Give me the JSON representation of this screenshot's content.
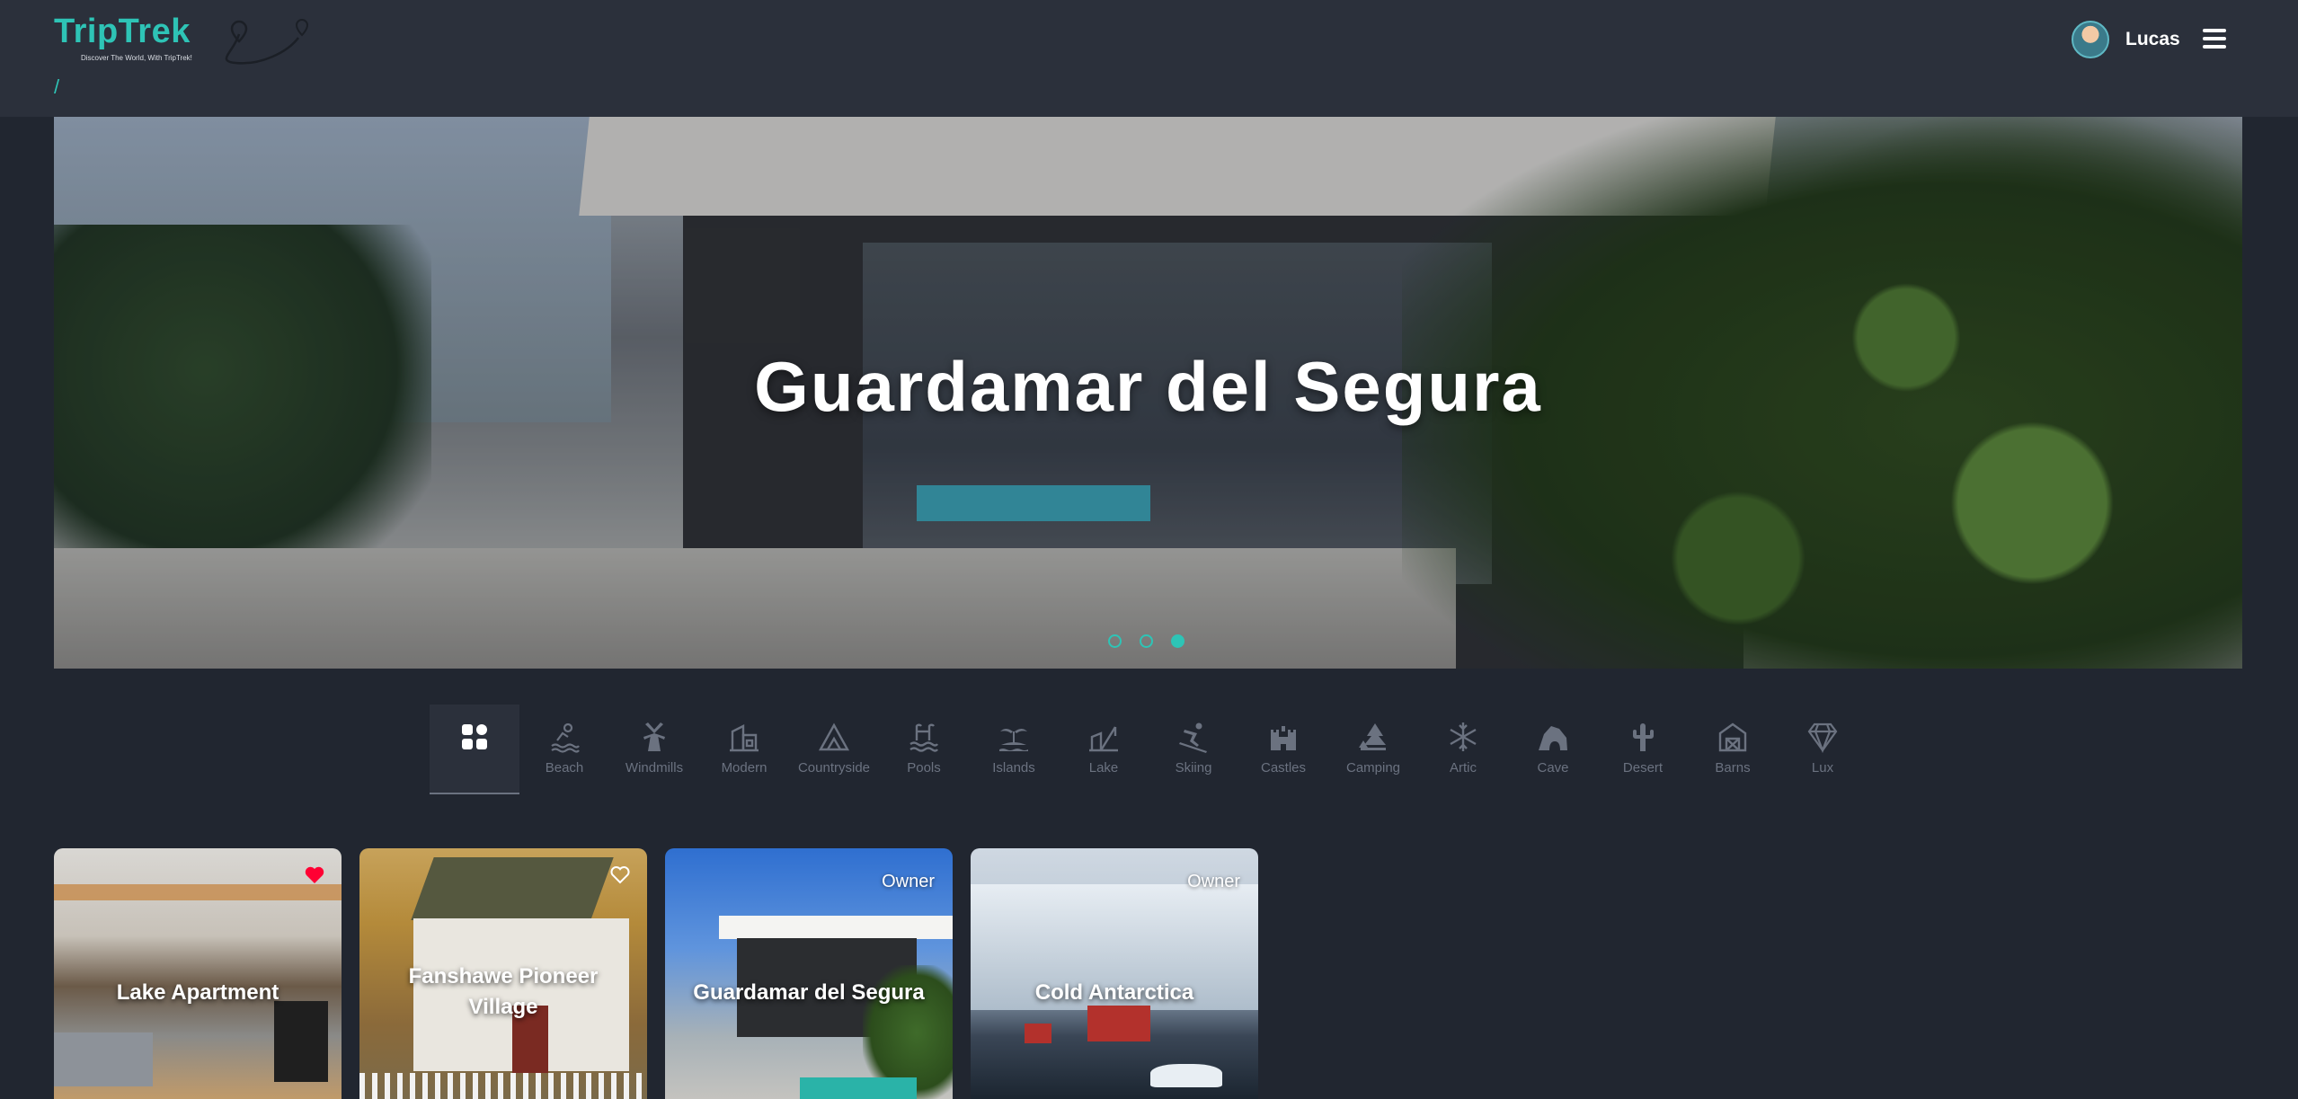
{
  "brand": {
    "name": "TripTrek",
    "tagline": "Discover The World, With TripTrek!",
    "accent": "#2ec4b6"
  },
  "breadcrumb": "/",
  "user": {
    "name": "Lucas"
  },
  "hero": {
    "title": "Guardamar del Segura",
    "slide_count": 3,
    "active_slide": 3
  },
  "categories": [
    {
      "label": "",
      "icon": "grid-icon",
      "active": true
    },
    {
      "label": "Beach",
      "icon": "beach-icon"
    },
    {
      "label": "Windmills",
      "icon": "windmill-icon"
    },
    {
      "label": "Modern",
      "icon": "modern-building-icon"
    },
    {
      "label": "Countryside",
      "icon": "mountain-icon"
    },
    {
      "label": "Pools",
      "icon": "pool-icon"
    },
    {
      "label": "Islands",
      "icon": "island-icon"
    },
    {
      "label": "Lake",
      "icon": "lake-icon"
    },
    {
      "label": "Skiing",
      "icon": "skiing-icon"
    },
    {
      "label": "Castles",
      "icon": "castle-icon"
    },
    {
      "label": "Camping",
      "icon": "camping-icon"
    },
    {
      "label": "Artic",
      "icon": "snowflake-icon"
    },
    {
      "label": "Cave",
      "icon": "cave-icon"
    },
    {
      "label": "Desert",
      "icon": "cactus-icon"
    },
    {
      "label": "Barns",
      "icon": "barn-icon"
    },
    {
      "label": "Lux",
      "icon": "diamond-icon"
    }
  ],
  "listings": [
    {
      "title": "Lake Apartment",
      "favorite": true,
      "badge": ""
    },
    {
      "title": "Fanshawe Pioneer Village",
      "favorite": false,
      "badge": ""
    },
    {
      "title": "Guardamar del Segura",
      "favorite": false,
      "badge": "Owner"
    },
    {
      "title": "Cold Antarctica",
      "favorite": false,
      "badge": "Owner"
    }
  ]
}
